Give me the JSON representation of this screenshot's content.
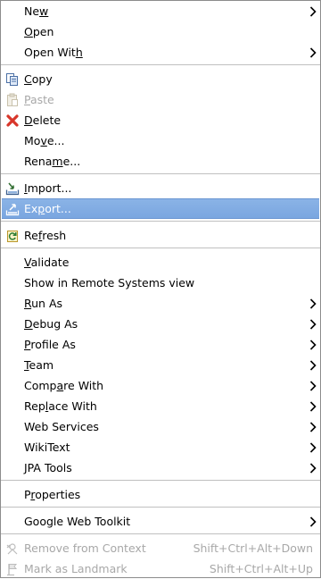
{
  "menu": {
    "items": [
      {
        "pre": "Ne",
        "mn": "w",
        "post": ""
      },
      {
        "pre": "",
        "mn": "O",
        "post": "pen"
      },
      {
        "pre": "Open Wit",
        "mn": "h",
        "post": ""
      },
      {
        "pre": "",
        "mn": "C",
        "post": "opy"
      },
      {
        "pre": "",
        "mn": "P",
        "post": "aste"
      },
      {
        "pre": "",
        "mn": "D",
        "post": "elete"
      },
      {
        "pre": "Mo",
        "mn": "v",
        "post": "e..."
      },
      {
        "pre": "Rena",
        "mn": "m",
        "post": "e..."
      },
      {
        "pre": "",
        "mn": "I",
        "post": "mport..."
      },
      {
        "pre": "Ex",
        "mn": "p",
        "post": "ort..."
      },
      {
        "pre": "Re",
        "mn": "f",
        "post": "resh"
      },
      {
        "pre": "",
        "mn": "V",
        "post": "alidate"
      },
      {
        "pre": "Show in Remote Systems view",
        "mn": "",
        "post": ""
      },
      {
        "pre": "",
        "mn": "R",
        "post": "un As"
      },
      {
        "pre": "",
        "mn": "D",
        "post": "ebug As"
      },
      {
        "pre": "",
        "mn": "P",
        "post": "rofile As"
      },
      {
        "pre": "",
        "mn": "T",
        "post": "eam"
      },
      {
        "pre": "Comp",
        "mn": "a",
        "post": "re With"
      },
      {
        "pre": "Rep",
        "mn": "l",
        "post": "ace With"
      },
      {
        "pre": "Web Services",
        "mn": "",
        "post": ""
      },
      {
        "pre": "WikiText",
        "mn": "",
        "post": ""
      },
      {
        "pre": "JPA Tools",
        "mn": "",
        "post": ""
      },
      {
        "pre": "P",
        "mn": "r",
        "post": "operties"
      },
      {
        "pre": "Google Web Toolkit",
        "mn": "",
        "post": ""
      },
      {
        "pre": "Remove from Context",
        "mn": "",
        "post": ""
      },
      {
        "pre": "Mark as Landmark",
        "mn": "",
        "post": ""
      }
    ],
    "accelerators": {
      "remove_from_context": "Shift+Ctrl+Alt+Down",
      "mark_as_landmark": "Shift+Ctrl+Alt+Up"
    },
    "colors": {
      "selection": "#7aa6e0",
      "disabled_text": "#a8a8a8",
      "delete_icon": "#d8362a"
    }
  }
}
